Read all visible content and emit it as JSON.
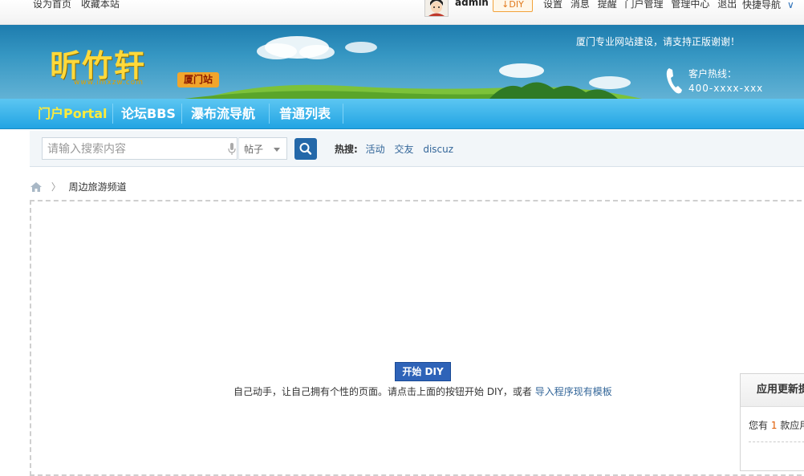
{
  "topbar": {
    "set_home": "设为首页",
    "bookmark": "收藏本站",
    "username": "admin",
    "diy_label": "DIY",
    "links": [
      "设置",
      "消息",
      "提醒",
      "门户管理",
      "管理中心",
      "退出"
    ],
    "quick_nav": "快捷导航"
  },
  "banner": {
    "logo": "昕竹轩",
    "logo_url": "www.imxzw.com",
    "station": "厦门站",
    "slogan": "厦门专业网站建设，请支持正版谢谢！",
    "hotline_label": "客户热线：",
    "hotline_number": "400-xxxx-xxx"
  },
  "nav": {
    "items": [
      "门户Portal",
      "论坛BBS",
      "瀑布流导航",
      "普通列表"
    ]
  },
  "search": {
    "placeholder": "请输入搜索内容",
    "scope": "帖子",
    "hot_label": "热搜:",
    "hot_terms": [
      "活动",
      "交友",
      "discuz"
    ]
  },
  "breadcrumb": {
    "current": "周边旅游频道"
  },
  "diy": {
    "start_button": "开始 DIY",
    "desc": "自己动手，让自己拥有个性的页面。请点击上面的按钮开始 DIY，或者",
    "import_link": "导入程序现有模板"
  },
  "app_update": {
    "title": "应用更新提醒",
    "text_prefix": "您有",
    "count": "1",
    "text_suffix": "款应用有更新"
  },
  "colors": {
    "nav_bg": "#22a4e3",
    "accent": "#2468a9",
    "link": "#336699"
  }
}
